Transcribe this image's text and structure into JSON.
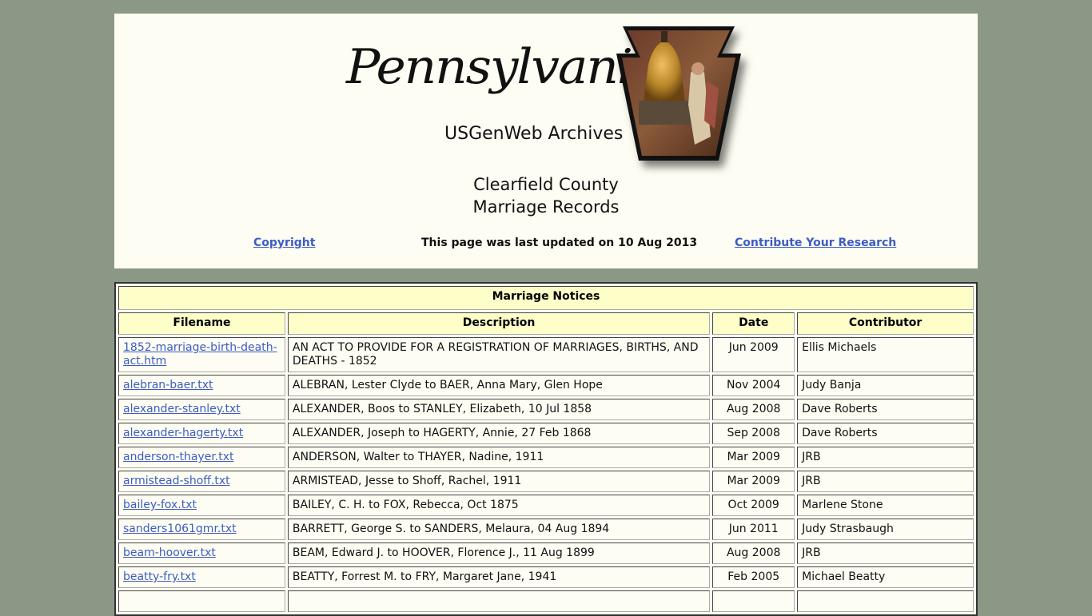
{
  "header": {
    "logo_script": "Pennsylvania",
    "logo_subtitle": "USGenWeb Archives",
    "logo_image": "keystone-liberty-bell-image",
    "county": "Clearfield County",
    "page_title": "Marriage Records",
    "copyright_link": "Copyright",
    "updated_text": "This page was last updated on 10 Aug 2013",
    "contribute_link": "Contribute Your Research"
  },
  "colors": {
    "page_background": "#8c9886",
    "panel_background": "#fdfdf3",
    "header_cell_background": "#fefec8",
    "link": "#3d5cc4"
  },
  "table": {
    "caption": "Marriage Notices",
    "columns": [
      "Filename",
      "Description",
      "Date",
      "Contributor"
    ],
    "rows": [
      {
        "filename": "1852-marriage-birth-death-act.htm",
        "description": "AN ACT TO PROVIDE FOR A REGISTRATION OF MARRIAGES, BIRTHS, AND DEATHS - 1852",
        "date": "Jun 2009",
        "contributor": "Ellis Michaels"
      },
      {
        "filename": "alebran-baer.txt",
        "description": "ALEBRAN, Lester Clyde to BAER, Anna Mary, Glen Hope",
        "date": "Nov 2004",
        "contributor": "Judy Banja"
      },
      {
        "filename": "alexander-stanley.txt",
        "description": "ALEXANDER, Boos to STANLEY, Elizabeth, 10 Jul 1858",
        "date": "Aug 2008",
        "contributor": "Dave Roberts"
      },
      {
        "filename": "alexander-hagerty.txt",
        "description": "ALEXANDER, Joseph to HAGERTY, Annie, 27 Feb 1868",
        "date": "Sep 2008",
        "contributor": "Dave Roberts"
      },
      {
        "filename": "anderson-thayer.txt",
        "description": "ANDERSON, Walter to THAYER, Nadine, 1911",
        "date": "Mar 2009",
        "contributor": "JRB"
      },
      {
        "filename": "armistead-shoff.txt",
        "description": "ARMISTEAD, Jesse to Shoff, Rachel, 1911",
        "date": "Mar 2009",
        "contributor": "JRB"
      },
      {
        "filename": "bailey-fox.txt",
        "description": "BAILEY, C. H. to FOX, Rebecca, Oct 1875",
        "date": "Oct 2009",
        "contributor": "Marlene Stone"
      },
      {
        "filename": "sanders1061gmr.txt",
        "description": "BARRETT, George S. to SANDERS, Melaura, 04 Aug 1894",
        "date": "Jun 2011",
        "contributor": "Judy Strasbaugh"
      },
      {
        "filename": "beam-hoover.txt",
        "description": "BEAM, Edward J. to HOOVER, Florence J., 11 Aug 1899",
        "date": "Aug 2008",
        "contributor": "JRB"
      },
      {
        "filename": "beatty-fry.txt",
        "description": "BEATTY, Forrest M. to FRY, Margaret Jane, 1941",
        "date": "Feb 2005",
        "contributor": "Michael Beatty"
      },
      {
        "filename": "",
        "description": "",
        "date": "",
        "contributor": ""
      }
    ]
  }
}
